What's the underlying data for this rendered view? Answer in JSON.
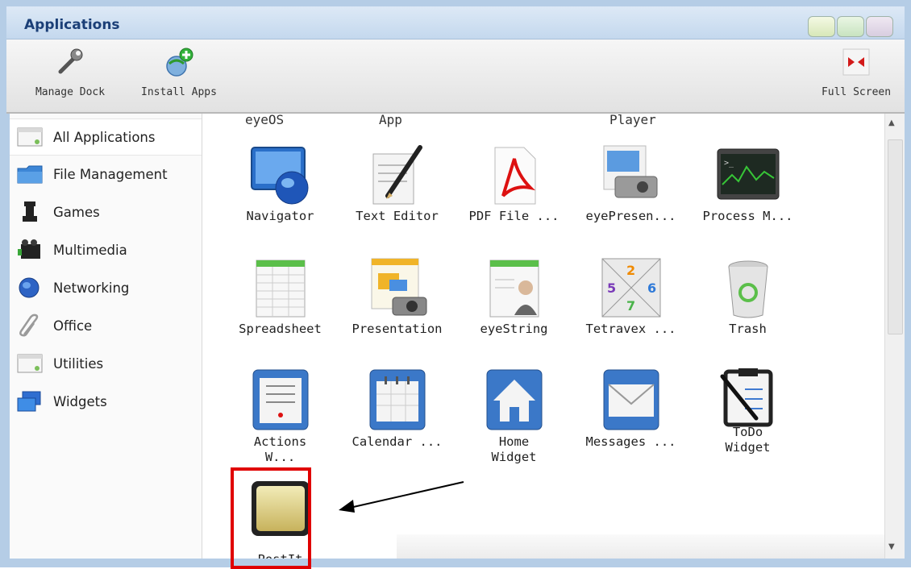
{
  "window": {
    "title": "Applications",
    "controls": [
      "minimize",
      "maximize",
      "close"
    ]
  },
  "toolbar": {
    "manage_dock": "Manage Dock",
    "install_apps": "Install Apps",
    "full_screen": "Full Screen"
  },
  "sidebar": {
    "items": [
      {
        "label": "All Applications",
        "icon": "window-icon",
        "selected": true
      },
      {
        "label": "File Management",
        "icon": "folder-icon"
      },
      {
        "label": "Games",
        "icon": "chess-piece-icon"
      },
      {
        "label": "Multimedia",
        "icon": "film-icon"
      },
      {
        "label": "Networking",
        "icon": "globe-icon"
      },
      {
        "label": "Office",
        "icon": "paperclip-icon"
      },
      {
        "label": "Utilities",
        "icon": "window-icon"
      },
      {
        "label": "Widgets",
        "icon": "widgets-icon"
      }
    ]
  },
  "partial_row": [
    "eyeOS",
    "App",
    "Player"
  ],
  "apps": [
    {
      "label": "Navigator",
      "icon": "navigator-globe-icon"
    },
    {
      "label": "Text Editor",
      "icon": "text-editor-pen-icon"
    },
    {
      "label": "PDF File ...",
      "icon": "pdf-icon"
    },
    {
      "label": "eyePresen...",
      "icon": "projector-icon"
    },
    {
      "label": "Process M...",
      "icon": "process-monitor-icon"
    },
    {
      "label": "Spreadsheet",
      "icon": "spreadsheet-icon"
    },
    {
      "label": "Presentation",
      "icon": "presentation-icon"
    },
    {
      "label": "eyeString",
      "icon": "eyestring-icon"
    },
    {
      "label": "Tetravex ...",
      "icon": "tetravex-icon"
    },
    {
      "label": "Trash",
      "icon": "trash-icon"
    },
    {
      "label": "Actions W...",
      "icon": "actions-widget-icon"
    },
    {
      "label": "Calendar ...",
      "icon": "calendar-icon"
    },
    {
      "label": "Home Widget",
      "icon": "home-icon"
    },
    {
      "label": "Messages ...",
      "icon": "envelope-icon"
    },
    {
      "label": "ToDo Widget",
      "icon": "todo-clipboard-icon"
    },
    {
      "label": "PostIt",
      "icon": "postit-note-icon",
      "highlighted": true
    }
  ],
  "tetravex_numbers": [
    "2",
    "5",
    "6",
    "7"
  ],
  "colors": {
    "title_text": "#1b3f77",
    "highlight_border": "#e00000"
  }
}
